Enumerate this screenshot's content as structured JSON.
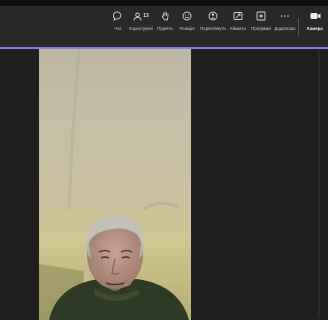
{
  "toolbar": {
    "items": [
      {
        "label": "Чат",
        "icon": "chat-icon"
      },
      {
        "label": "Користувачі",
        "icon": "people-icon",
        "count": "13"
      },
      {
        "label": "Підняти",
        "icon": "raise-hand-icon"
      },
      {
        "label": "Реакція",
        "icon": "reaction-icon"
      },
      {
        "label": "Переглянути",
        "icon": "view-icon"
      },
      {
        "label": "Кімнати",
        "icon": "rooms-icon"
      },
      {
        "label": "Програми",
        "icon": "apps-icon"
      },
      {
        "label": "Додатково",
        "icon": "more-icon"
      },
      {
        "label": "Камера",
        "icon": "camera-icon"
      }
    ],
    "accent": "#7b83eb"
  },
  "stage": {
    "video_tile": "participant-video",
    "background": "#1f1f1f"
  }
}
